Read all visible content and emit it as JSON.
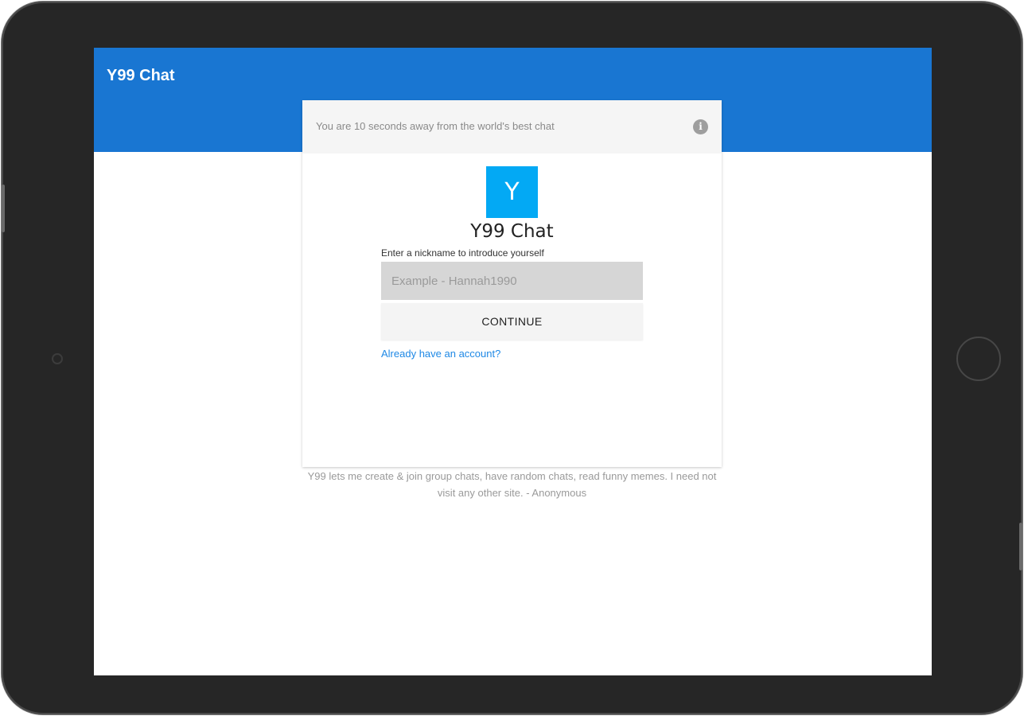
{
  "appbar": {
    "title": "Y99 Chat"
  },
  "card": {
    "header_text": "You are 10 seconds away from the world's best chat",
    "info_icon": "info-icon",
    "info_glyph": "i",
    "logo_letter": "Y",
    "brand_name": "Y99 Chat",
    "nickname_label": "Enter a nickname to introduce yourself",
    "nickname_placeholder": "Example - Hannah1990",
    "nickname_value": "",
    "continue_label": "CONTINUE",
    "account_link": "Already have an account?"
  },
  "testimonial": "Y99 lets me create & join group chats, have random chats, read funny memes. I need not visit any other site. - Anonymous",
  "colors": {
    "appbar": "#1976d2",
    "logo": "#03a9f4",
    "link": "#1e88e5",
    "device_frame": "#262626"
  }
}
